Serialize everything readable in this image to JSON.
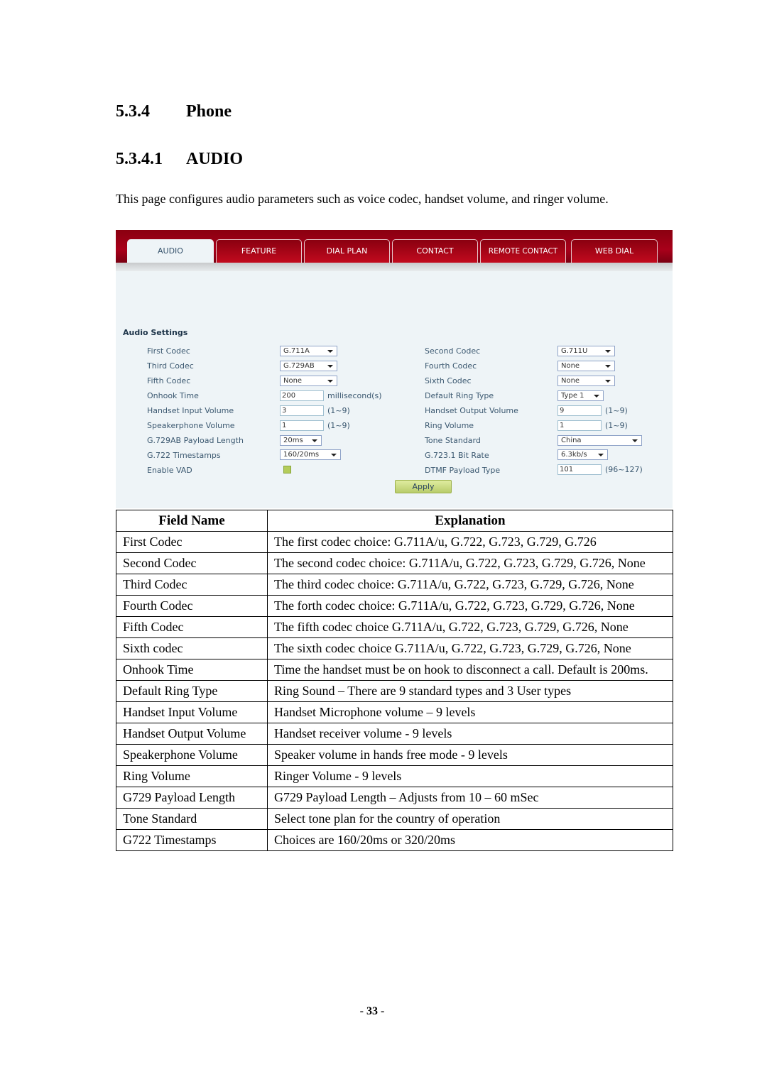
{
  "headings": {
    "section_num": "5.3.4",
    "section_title": "Phone",
    "subsection_num": "5.3.4.1",
    "subsection_title": "AUDIO"
  },
  "intro": "This page configures audio parameters such as voice codec, handset volume, and ringer volume.",
  "panel": {
    "tabs": [
      {
        "label": "AUDIO",
        "active": true
      },
      {
        "label": "FEATURE",
        "active": false
      },
      {
        "label": "DIAL PLAN",
        "active": false
      },
      {
        "label": "CONTACT",
        "active": false
      },
      {
        "label": "REMOTE CONTACT",
        "active": false
      },
      {
        "label": "WEB DIAL",
        "active": false
      }
    ],
    "section_title": "Audio Settings",
    "left": {
      "first_codec": {
        "label": "First Codec",
        "value": "G.711A"
      },
      "third_codec": {
        "label": "Third Codec",
        "value": "G.729AB"
      },
      "fifth_codec": {
        "label": "Fifth Codec",
        "value": "None"
      },
      "onhook_time": {
        "label": "Onhook Time",
        "value": "200",
        "hint": "millisecond(s)"
      },
      "handset_input_volume": {
        "label": "Handset Input Volume",
        "value": "3",
        "hint": "(1~9)"
      },
      "speakerphone_volume": {
        "label": "Speakerphone Volume",
        "value": "1",
        "hint": "(1~9)"
      },
      "g729ab_payload": {
        "label": "G.729AB Payload Length",
        "value": "20ms"
      },
      "g722_timestamps": {
        "label": "G.722 Timestamps",
        "value": "160/20ms"
      },
      "enable_vad": {
        "label": "Enable VAD",
        "checked": false
      }
    },
    "right": {
      "second_codec": {
        "label": "Second Codec",
        "value": "G.711U"
      },
      "fourth_codec": {
        "label": "Fourth Codec",
        "value": "None"
      },
      "sixth_codec": {
        "label": "Sixth Codec",
        "value": "None"
      },
      "default_ring_type": {
        "label": "Default Ring Type",
        "value": "Type 1"
      },
      "handset_output_volume": {
        "label": "Handset Output Volume",
        "value": "9",
        "hint": "(1~9)"
      },
      "ring_volume": {
        "label": "Ring Volume",
        "value": "1",
        "hint": "(1~9)"
      },
      "tone_standard": {
        "label": "Tone Standard",
        "value": "China"
      },
      "g7231_bit_rate": {
        "label": "G.723.1 Bit Rate",
        "value": "6.3kb/s"
      },
      "dtmf_payload_type": {
        "label": "DTMF Payload Type",
        "value": "101",
        "hint": "(96~127)"
      }
    },
    "apply_label": "Apply"
  },
  "table": {
    "headers": [
      "Field Name",
      "Explanation"
    ],
    "rows": [
      [
        "First Codec",
        "The first codec choice: G.711A/u, G.722, G.723, G.729, G.726"
      ],
      [
        "Second Codec",
        "The second codec choice: G.711A/u, G.722, G.723, G.729, G.726, None"
      ],
      [
        "Third Codec",
        "The third codec choice: G.711A/u, G.722, G.723, G.729, G.726, None"
      ],
      [
        "Fourth Codec",
        "The forth codec choice: G.711A/u, G.722, G.723, G.729, G.726, None"
      ],
      [
        "Fifth Codec",
        "The fifth codec choice G.711A/u, G.722, G.723, G.729, G.726, None"
      ],
      [
        "Sixth codec",
        "The sixth codec choice G.711A/u, G.722, G.723, G.729, G.726, None"
      ],
      [
        "Onhook Time",
        "Time the handset must be on hook to disconnect a call. Default is 200ms."
      ],
      [
        "Default Ring Type",
        "Ring Sound – There are 9 standard types and 3 User types"
      ],
      [
        "Handset Input Volume",
        "Handset Microphone volume – 9 levels"
      ],
      [
        "Handset Output Volume",
        "Handset receiver volume - 9 levels"
      ],
      [
        "Speakerphone Volume",
        "Speaker volume in hands free mode - 9 levels"
      ],
      [
        "Ring Volume",
        "Ringer Volume - 9 levels"
      ],
      [
        "G729 Payload Length",
        "G729 Payload Length – Adjusts from 10 – 60 mSec"
      ],
      [
        "Tone Standard",
        "Select tone plan for the country of operation"
      ],
      [
        "G722 Timestamps",
        "Choices are 160/20ms or 320/20ms"
      ]
    ]
  },
  "page_number": "- 33 -"
}
